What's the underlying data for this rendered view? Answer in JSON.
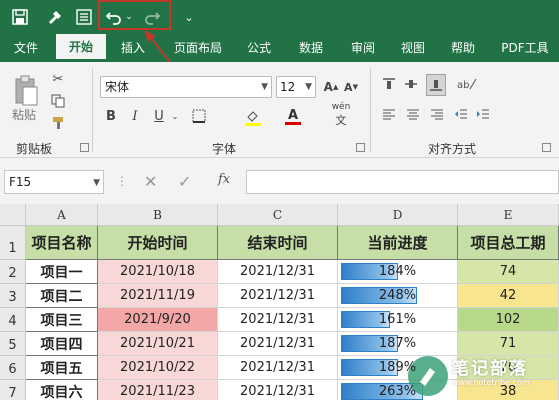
{
  "quick_access": {
    "save_icon": "save-icon",
    "brush_icon": "format-painter-icon",
    "form_icon": "form-icon",
    "undo_icon": "undo-icon",
    "redo_icon": "redo-icon",
    "customize_icon": "customize-qat-icon",
    "highlight_color": "#c0392b"
  },
  "tabs": [
    {
      "label": "文件"
    },
    {
      "label": "开始"
    },
    {
      "label": "插入"
    },
    {
      "label": "页面布局"
    },
    {
      "label": "公式"
    },
    {
      "label": "数据"
    },
    {
      "label": "审阅"
    },
    {
      "label": "视图"
    },
    {
      "label": "帮助"
    },
    {
      "label": "PDF工具"
    }
  ],
  "ribbon": {
    "clipboard": {
      "paste_label": "粘贴",
      "group_label": "剪贴板"
    },
    "font": {
      "font_name": "宋体",
      "font_size": "12",
      "group_label": "字体",
      "bold": "B",
      "italic": "I",
      "underline": "U",
      "phonetic": "wén"
    },
    "alignment": {
      "group_label": "对齐方式"
    }
  },
  "formula_bar": {
    "name_box": "F15",
    "fx_label": "fx",
    "formula": ""
  },
  "sheet": {
    "columns": [
      "A",
      "B",
      "C",
      "D",
      "E"
    ],
    "rows": [
      "1",
      "2",
      "3",
      "4",
      "5",
      "6",
      "7"
    ],
    "headers": [
      "项目名称",
      "开始时间",
      "结束时间",
      "当前进度",
      "项目总工期"
    ],
    "data": [
      {
        "name": "项目一",
        "start": "2021/10/18",
        "end": "2021/12/31",
        "progress": "184%",
        "progress_fill": 0.5,
        "duration": "74"
      },
      {
        "name": "项目二",
        "start": "2021/11/19",
        "end": "2021/12/31",
        "progress": "248%",
        "progress_fill": 0.67,
        "duration": "42"
      },
      {
        "name": "项目三",
        "start": "2021/9/20",
        "end": "2021/12/31",
        "progress": "161%",
        "progress_fill": 0.43,
        "duration": "102"
      },
      {
        "name": "项目四",
        "start": "2021/10/21",
        "end": "2021/12/31",
        "progress": "187%",
        "progress_fill": 0.5,
        "duration": "71"
      },
      {
        "name": "项目五",
        "start": "2021/10/22",
        "end": "2021/12/31",
        "progress": "189%",
        "progress_fill": 0.5,
        "duration": "70"
      },
      {
        "name": "项目六",
        "start": "2021/11/23",
        "end": "2021/12/31",
        "progress": "263%",
        "progress_fill": 0.72,
        "duration": "38"
      }
    ]
  },
  "watermark": {
    "title": "笔记部落",
    "subtitle": "www.notetribe.com"
  },
  "colors": {
    "excel_green": "#217346",
    "header_fill": "#c6dfa7"
  }
}
